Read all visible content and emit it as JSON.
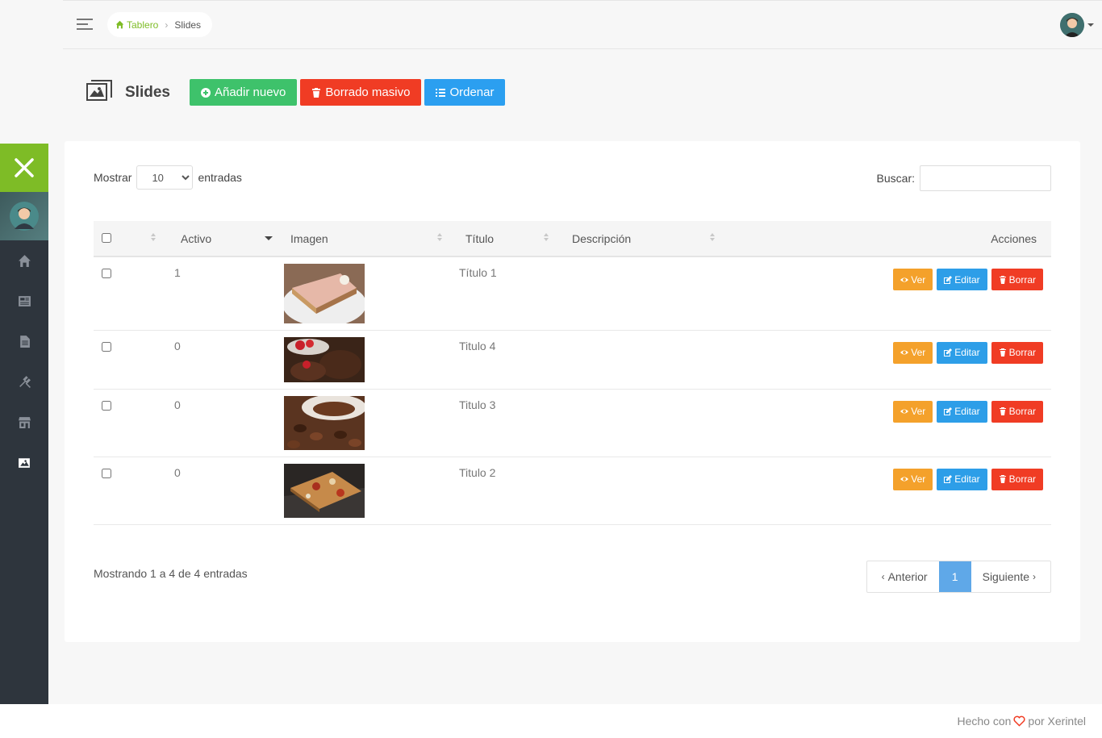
{
  "breadcrumb": {
    "home": "Tablero",
    "current": "Slides"
  },
  "page": {
    "title": "Slides",
    "add_label": "Añadir nuevo",
    "mass_delete_label": "Borrado masivo",
    "order_label": "Ordenar"
  },
  "table_controls": {
    "show_label": "Mostrar",
    "length_value": "10",
    "entries_label": "entradas",
    "search_label": "Buscar:",
    "search_value": ""
  },
  "columns": {
    "activo": "Activo",
    "imagen": "Imagen",
    "titulo": "Título",
    "descripcion": "Descripción",
    "acciones": "Acciones"
  },
  "rows": [
    {
      "activo": "1",
      "titulo": "Título 1",
      "descripcion": "",
      "image": "cake-slice"
    },
    {
      "activo": "0",
      "titulo": "Titulo 4",
      "descripcion": "",
      "image": "chocolate-strawberry"
    },
    {
      "activo": "0",
      "titulo": "Titulo 3",
      "descripcion": "",
      "image": "coffee-beans"
    },
    {
      "activo": "0",
      "titulo": "Titulo 2",
      "descripcion": "",
      "image": "pizza"
    }
  ],
  "actions": {
    "view": "Ver",
    "edit": "Editar",
    "delete": "Borrar"
  },
  "info": "Mostrando 1 a 4 de 4 entradas",
  "pagination": {
    "prev": "Anterior",
    "current": "1",
    "next": "Siguiente"
  },
  "footer": {
    "made_with": "Hecho con",
    "by": "por Xerintel"
  },
  "colors": {
    "brand_green": "#7ebc26",
    "sidebar": "#2e353d",
    "btn_add": "#3ec26b",
    "btn_delete": "#f03c24",
    "btn_order": "#2b9ff0",
    "btn_view": "#f4a12b",
    "btn_edit": "#2d9ee8"
  }
}
